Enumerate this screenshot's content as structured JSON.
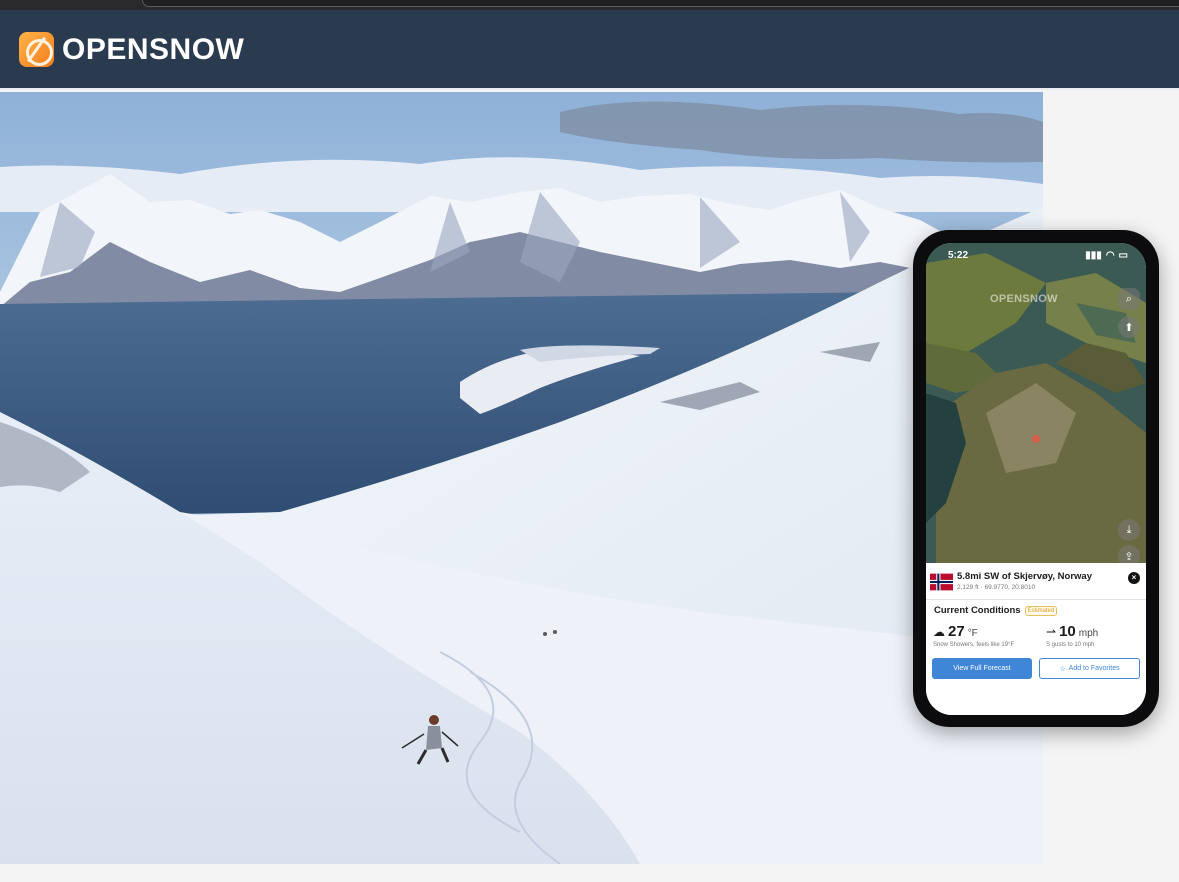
{
  "brand": {
    "name": "OPENSNOW"
  },
  "phone": {
    "status": {
      "time": "5:22"
    },
    "map": {
      "watermark": "OPENSNOW"
    },
    "location": {
      "title": "5.8mi SW of Skjervøy, Norway",
      "subtitle": "2,129 ft · 69.9770, 20.8010"
    },
    "conditions": {
      "title": "Current Conditions",
      "badge": "Estimated",
      "temp": "27",
      "temp_unit": "°F",
      "temp_desc": "Snow Showers, feels like 19°F",
      "wind": "10",
      "wind_unit": "mph",
      "wind_desc": "S gusts to 10 mph"
    },
    "buttons": {
      "full_forecast": "View Full Forecast",
      "favorites": "Add to Favorites"
    }
  }
}
